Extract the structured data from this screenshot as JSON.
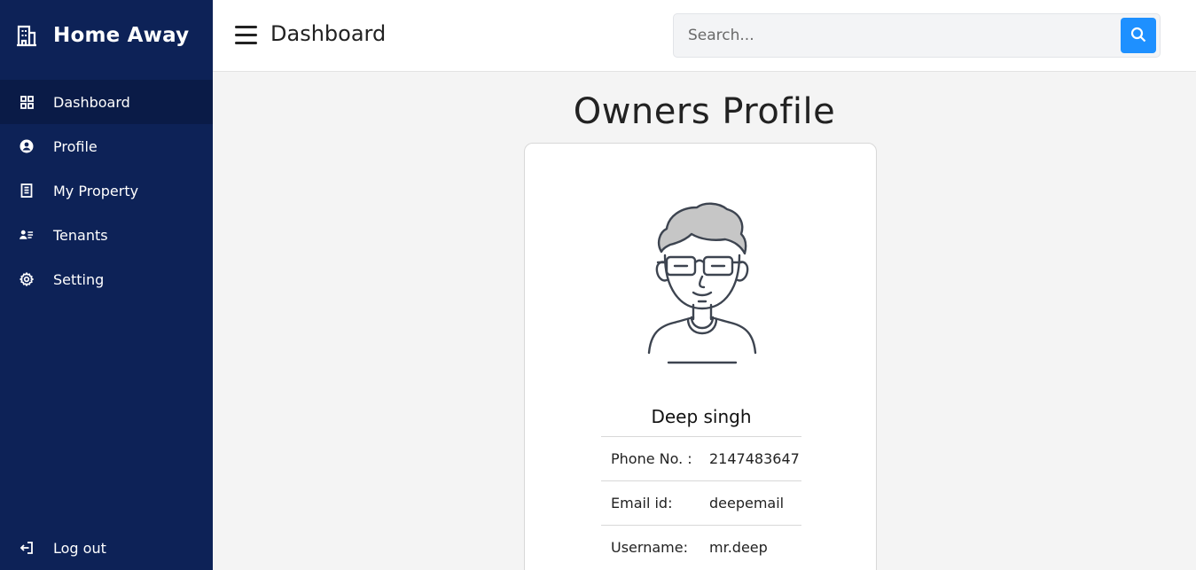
{
  "brand": {
    "name": "Home Away",
    "icon": "building-icon"
  },
  "sidebar": {
    "items": [
      {
        "label": "Dashboard",
        "icon": "grid-icon",
        "active": true
      },
      {
        "label": "Profile",
        "icon": "user-circle-icon",
        "active": false
      },
      {
        "label": "My Property",
        "icon": "building-icon",
        "active": false
      },
      {
        "label": "Tenants",
        "icon": "users-list-icon",
        "active": false
      },
      {
        "label": "Setting",
        "icon": "gear-icon",
        "active": false
      }
    ],
    "logout_label": "Log out"
  },
  "topbar": {
    "title": "Dashboard",
    "search_placeholder": "Search..."
  },
  "main": {
    "heading": "Owners Profile",
    "owner": {
      "name": "Deep singh",
      "fields": [
        {
          "label": "Phone No. :",
          "value": "2147483647"
        },
        {
          "label": "Email id:",
          "value": "deepemail"
        },
        {
          "label": "Username:",
          "value": "mr.deep"
        }
      ]
    }
  },
  "colors": {
    "sidebar_bg": "#0d2257",
    "sidebar_active": "#0a1b47",
    "accent": "#1e90ff",
    "page_bg": "#f4f4f4"
  }
}
